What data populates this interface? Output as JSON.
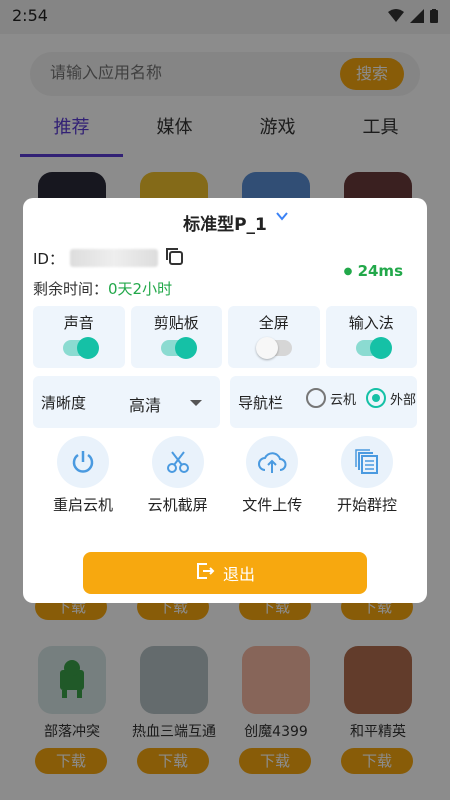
{
  "status": {
    "time": "2:54"
  },
  "search": {
    "placeholder": "请输入应用名称",
    "button": "搜索"
  },
  "tabs": [
    "推荐",
    "媒体",
    "游戏",
    "工具"
  ],
  "apps": [
    {
      "name": "部落冲突",
      "download": "下载",
      "color": "#d8e8e8"
    },
    {
      "name": "热血三端互通",
      "download": "下载",
      "color": "#b7c3c6"
    },
    {
      "name": "创魔4399",
      "download": "下载",
      "color": "#f6b8a3"
    },
    {
      "name": "和平精英",
      "download": "下载",
      "color": "#b26e4f"
    }
  ],
  "row1_download": "下载",
  "dialog": {
    "title": "标准型P_1",
    "id_label": "ID：",
    "time_label": "剩余时间：",
    "time_value": "0天2小时",
    "latency": "24ms",
    "toggles": [
      {
        "label": "声音",
        "on": true
      },
      {
        "label": "剪贴板",
        "on": true
      },
      {
        "label": "全屏",
        "on": false
      },
      {
        "label": "输入法",
        "on": true
      }
    ],
    "clarity_label": "清晰度",
    "clarity_value": "高清",
    "nav_label": "导航栏",
    "nav_options": [
      "云机",
      "外部"
    ],
    "nav_selected": "外部",
    "actions": [
      {
        "label": "重启云机",
        "icon": "power-icon"
      },
      {
        "label": "云机截屏",
        "icon": "scissors-icon"
      },
      {
        "label": "文件上传",
        "icon": "cloud-upload-icon"
      },
      {
        "label": "开始群控",
        "icon": "multi-control-icon"
      }
    ],
    "exit": "退出"
  }
}
